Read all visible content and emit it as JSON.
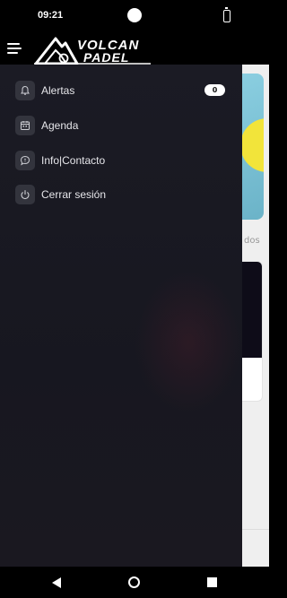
{
  "status_bar": {
    "time": "09:21"
  },
  "app": {
    "logo_line1": "VOLCAN",
    "logo_line2": "PADEL"
  },
  "background": {
    "partial_text": "dos"
  },
  "drawer": {
    "items": [
      {
        "label": "Alertas",
        "icon": "bell-icon",
        "badge": "0"
      },
      {
        "label": "Agenda",
        "icon": "calendar-icon"
      },
      {
        "label": "Info|Contacto",
        "icon": "chat-icon"
      },
      {
        "label": "Cerrar sesión",
        "icon": "power-icon"
      }
    ]
  },
  "colors": {
    "drawer_bg": "#1b1b24",
    "icon_bg": "#33343d",
    "text": "#e6e6ea",
    "bar_bg": "#000000"
  }
}
